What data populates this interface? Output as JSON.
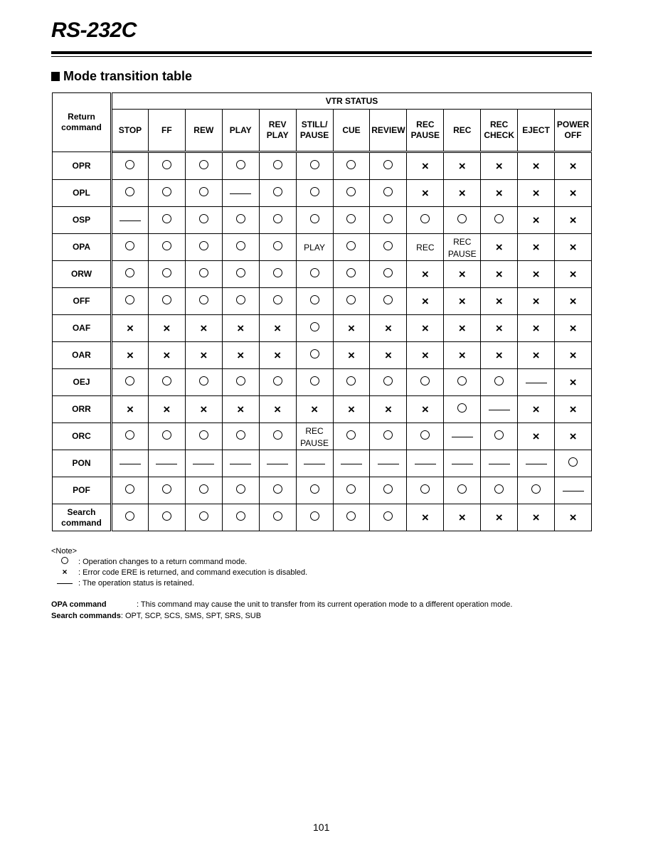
{
  "header": {
    "title": "RS-232C"
  },
  "section": {
    "heading": "Mode transition table"
  },
  "table": {
    "corner_header": [
      "Return",
      "command"
    ],
    "group_header": "VTR STATUS",
    "columns": [
      [
        "STOP"
      ],
      [
        "FF"
      ],
      [
        "REW"
      ],
      [
        "PLAY"
      ],
      [
        "REV",
        "PLAY"
      ],
      [
        "STILL/",
        "PAUSE"
      ],
      [
        "CUE"
      ],
      [
        "REVIEW"
      ],
      [
        "REC",
        "PAUSE"
      ],
      [
        "REC"
      ],
      [
        "REC",
        "CHECK"
      ],
      [
        "EJECT"
      ],
      [
        "POWER",
        "OFF"
      ]
    ],
    "rows": [
      {
        "command": [
          "OPR"
        ],
        "cells": [
          "O",
          "O",
          "O",
          "O",
          "O",
          "O",
          "O",
          "O",
          "X",
          "X",
          "X",
          "X",
          "X"
        ]
      },
      {
        "command": [
          "OPL"
        ],
        "cells": [
          "O",
          "O",
          "O",
          "-",
          "O",
          "O",
          "O",
          "O",
          "X",
          "X",
          "X",
          "X",
          "X"
        ]
      },
      {
        "command": [
          "OSP"
        ],
        "cells": [
          "-",
          "O",
          "O",
          "O",
          "O",
          "O",
          "O",
          "O",
          "O",
          "O",
          "O",
          "X",
          "X"
        ]
      },
      {
        "command": [
          "OPA"
        ],
        "cells": [
          "O",
          "O",
          "O",
          "O",
          "O",
          "PLAY",
          "O",
          "O",
          "REC",
          "REC PAUSE",
          "X",
          "X",
          "X"
        ]
      },
      {
        "command": [
          "ORW"
        ],
        "cells": [
          "O",
          "O",
          "O",
          "O",
          "O",
          "O",
          "O",
          "O",
          "X",
          "X",
          "X",
          "X",
          "X"
        ]
      },
      {
        "command": [
          "OFF"
        ],
        "cells": [
          "O",
          "O",
          "O",
          "O",
          "O",
          "O",
          "O",
          "O",
          "X",
          "X",
          "X",
          "X",
          "X"
        ]
      },
      {
        "command": [
          "OAF"
        ],
        "cells": [
          "X",
          "X",
          "X",
          "X",
          "X",
          "O",
          "X",
          "X",
          "X",
          "X",
          "X",
          "X",
          "X"
        ]
      },
      {
        "command": [
          "OAR"
        ],
        "cells": [
          "X",
          "X",
          "X",
          "X",
          "X",
          "O",
          "X",
          "X",
          "X",
          "X",
          "X",
          "X",
          "X"
        ]
      },
      {
        "command": [
          "OEJ"
        ],
        "cells": [
          "O",
          "O",
          "O",
          "O",
          "O",
          "O",
          "O",
          "O",
          "O",
          "O",
          "O",
          "-",
          "X"
        ]
      },
      {
        "command": [
          "ORR"
        ],
        "cells": [
          "X",
          "X",
          "X",
          "X",
          "X",
          "X",
          "X",
          "X",
          "X",
          "O",
          "-",
          "X",
          "X"
        ]
      },
      {
        "command": [
          "ORC"
        ],
        "cells": [
          "O",
          "O",
          "O",
          "O",
          "O",
          "REC PAUSE",
          "O",
          "O",
          "O",
          "-",
          "O",
          "X",
          "X"
        ]
      },
      {
        "command": [
          "PON"
        ],
        "cells": [
          "-",
          "-",
          "-",
          "-",
          "-",
          "-",
          "-",
          "-",
          "-",
          "-",
          "-",
          "-",
          "O"
        ]
      },
      {
        "command": [
          "POF"
        ],
        "cells": [
          "O",
          "O",
          "O",
          "O",
          "O",
          "O",
          "O",
          "O",
          "O",
          "O",
          "O",
          "O",
          "-"
        ]
      },
      {
        "command": [
          "Search",
          "command"
        ],
        "cells": [
          "O",
          "O",
          "O",
          "O",
          "O",
          "O",
          "O",
          "O",
          "X",
          "X",
          "X",
          "X",
          "X"
        ]
      }
    ]
  },
  "notes": {
    "title": "<Note>",
    "items": [
      {
        "symbol": "O",
        "text": ": Operation changes to a return command mode."
      },
      {
        "symbol": "X",
        "text": ": Error code ERE is returned, and command execution is disabled."
      },
      {
        "symbol": "-",
        "text": ": The operation status is retained."
      }
    ]
  },
  "definitions": [
    {
      "term": "OPA command",
      "text": ": This command may cause the unit to transfer from its current operation mode to a different operation mode."
    },
    {
      "term": "Search commands",
      "text": " : OPT, SCP, SCS, SMS, SPT, SRS, SUB"
    }
  ],
  "page_number": "101"
}
